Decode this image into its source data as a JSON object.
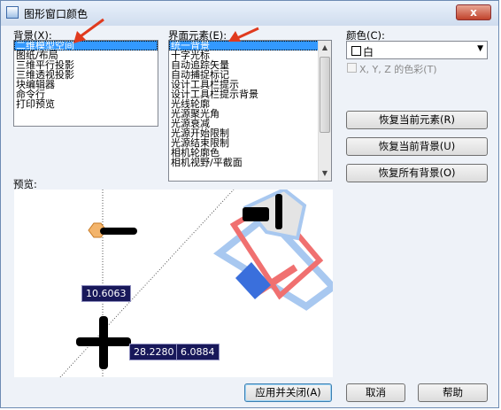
{
  "window": {
    "title": "图形窗口颜色",
    "close_glyph": "x"
  },
  "context": {
    "label": "背景(X):",
    "items": [
      "二维模型空间",
      "图纸/布局",
      "三维平行投影",
      "三维透视投影",
      "块编辑器",
      "命令行",
      "打印预览"
    ],
    "selected": 0
  },
  "interface": {
    "label": "界面元素(E):",
    "items": [
      "统一背景",
      "十字光标",
      "自动追踪矢量",
      "自动捕捉标记",
      "设计工具栏提示",
      "设计工具栏提示背景",
      "光线轮廓",
      "光源聚光角",
      "光源衰减",
      "光源开始限制",
      "光源结束限制",
      "相机轮廓色",
      "相机视野/平截面"
    ],
    "selected": 0
  },
  "color": {
    "label": "颜色(C):",
    "value": "白",
    "swatch_color": "#ffffff",
    "tint_checkbox_label": "X, Y, Z 的色彩(T)",
    "tint_checkbox_checked": false
  },
  "buttons": {
    "restore_element": "恢复当前元素(R)",
    "restore_context": "恢复当前背景(U)",
    "restore_all": "恢复所有背景(O)",
    "apply_close": "应用并关闭(A)",
    "cancel": "取消",
    "help": "帮助"
  },
  "preview": {
    "label": "预览:",
    "tag1": "10.6063",
    "tag2": "28.2280",
    "tag3": "6.0884"
  },
  "colors": {
    "selection": "#3399ff",
    "annotation_arrow": "#e03a1e",
    "tag_background": "#18185a"
  }
}
